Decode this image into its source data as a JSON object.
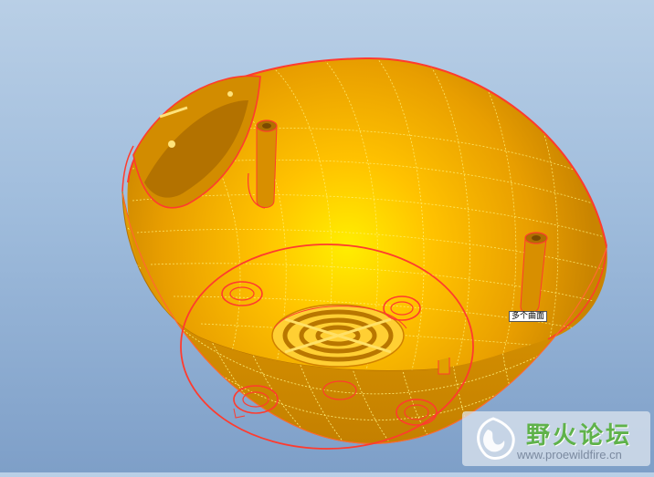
{
  "viewport": {
    "background_top": "#b9cfe6",
    "background_bottom": "#7e9fc8"
  },
  "model": {
    "surface_color": "#f2a600",
    "highlight_color": "#ffe000",
    "edge_highlight_color": "#ff3b2e",
    "mesh_color": "#fff27a"
  },
  "annotation": {
    "label": "多个曲面"
  },
  "watermark": {
    "title": "野火论坛",
    "url": "www.proewildfire.cn",
    "title_color": "#5fb24a",
    "url_color": "#7b8aa0"
  }
}
